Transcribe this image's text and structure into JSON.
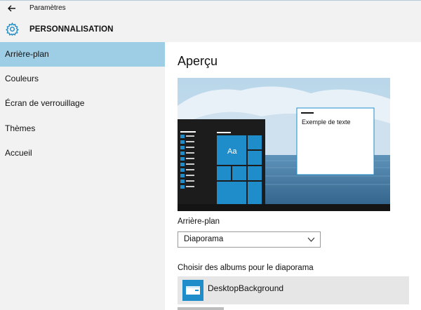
{
  "window": {
    "title": "Paramètres",
    "back_icon": "back-arrow-icon"
  },
  "header": {
    "title": "PERSONNALISATION",
    "icon": "gear-icon",
    "accent": "#1e8dc9"
  },
  "sidebar": {
    "active_color": "#9ecde6",
    "items": [
      {
        "label": "Arrière-plan",
        "selected": true
      },
      {
        "label": "Couleurs",
        "selected": false
      },
      {
        "label": "Écran de verrouillage",
        "selected": false
      },
      {
        "label": "Thèmes",
        "selected": false
      },
      {
        "label": "Accueil",
        "selected": false
      }
    ]
  },
  "main": {
    "preview_title": "Aperçu",
    "preview": {
      "start_tile_text": "Aa",
      "sample_window_text": "Exemple de texte",
      "tile_color": "#1e8dc9"
    },
    "background_label": "Arrière-plan",
    "background_select": {
      "value": "Diaporama"
    },
    "albums_label": "Choisir des albums pour le diaporama",
    "album": {
      "name": "DesktopBackground",
      "icon": "folder-icon"
    }
  }
}
